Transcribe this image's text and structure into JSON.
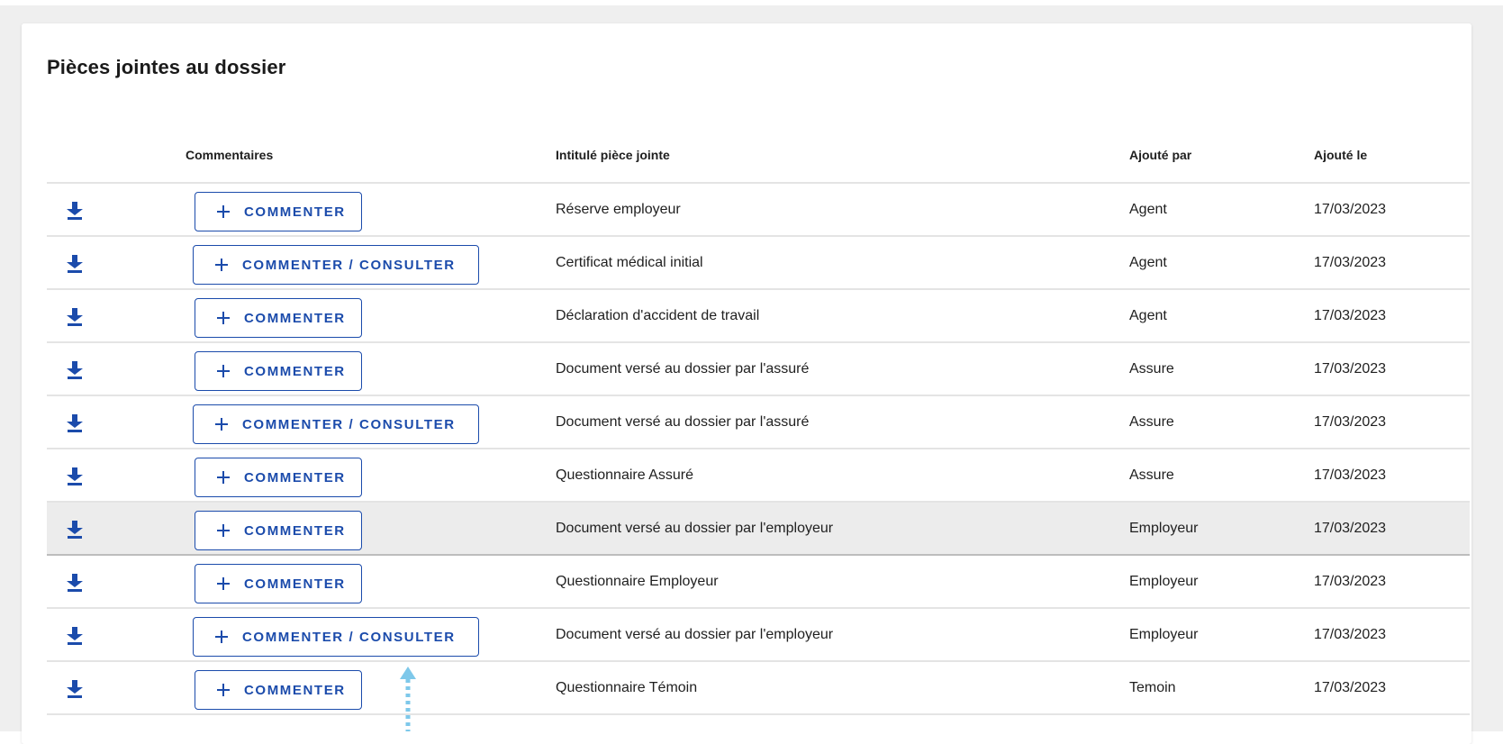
{
  "section": {
    "title": "Pièces jointes au dossier"
  },
  "table": {
    "headers": {
      "comments": "Commentaires",
      "title": "Intitulé pièce jointe",
      "added_by": "Ajouté par",
      "added_on": "Ajouté le"
    },
    "rows": [
      {
        "button": "COMMENTER",
        "title": "Réserve employeur",
        "added_by": "Agent",
        "added_on": "17/03/2023"
      },
      {
        "button": "COMMENTER / CONSULTER",
        "title": "Certificat médical initial",
        "added_by": "Agent",
        "added_on": "17/03/2023"
      },
      {
        "button": "COMMENTER",
        "title": "Déclaration d'accident de travail",
        "added_by": "Agent",
        "added_on": "17/03/2023"
      },
      {
        "button": "COMMENTER",
        "title": "Document versé au dossier par l'assuré",
        "added_by": "Assure",
        "added_on": "17/03/2023"
      },
      {
        "button": "COMMENTER / CONSULTER",
        "title": "Document versé au dossier par l'assuré",
        "added_by": "Assure",
        "added_on": "17/03/2023"
      },
      {
        "button": "COMMENTER",
        "title": "Questionnaire Assuré",
        "added_by": "Assure",
        "added_on": "17/03/2023"
      },
      {
        "button": "COMMENTER",
        "title": "Document versé au dossier par l'employeur",
        "added_by": "Employeur",
        "added_on": "17/03/2023",
        "highlighted": true
      },
      {
        "button": "COMMENTER",
        "title": "Questionnaire Employeur",
        "added_by": "Employeur",
        "added_on": "17/03/2023"
      },
      {
        "button": "COMMENTER / CONSULTER",
        "title": "Document versé au dossier par l'employeur",
        "added_by": "Employeur",
        "added_on": "17/03/2023"
      },
      {
        "button": "COMMENTER",
        "title": "Questionnaire Témoin",
        "added_by": "Temoin",
        "added_on": "17/03/2023"
      }
    ]
  },
  "icons": {
    "download": "download-icon",
    "plus": "plus-icon"
  },
  "colors": {
    "accent": "#1b4bab",
    "row_highlight": "#ececec",
    "annotation_arrow": "#7ec8ea"
  }
}
